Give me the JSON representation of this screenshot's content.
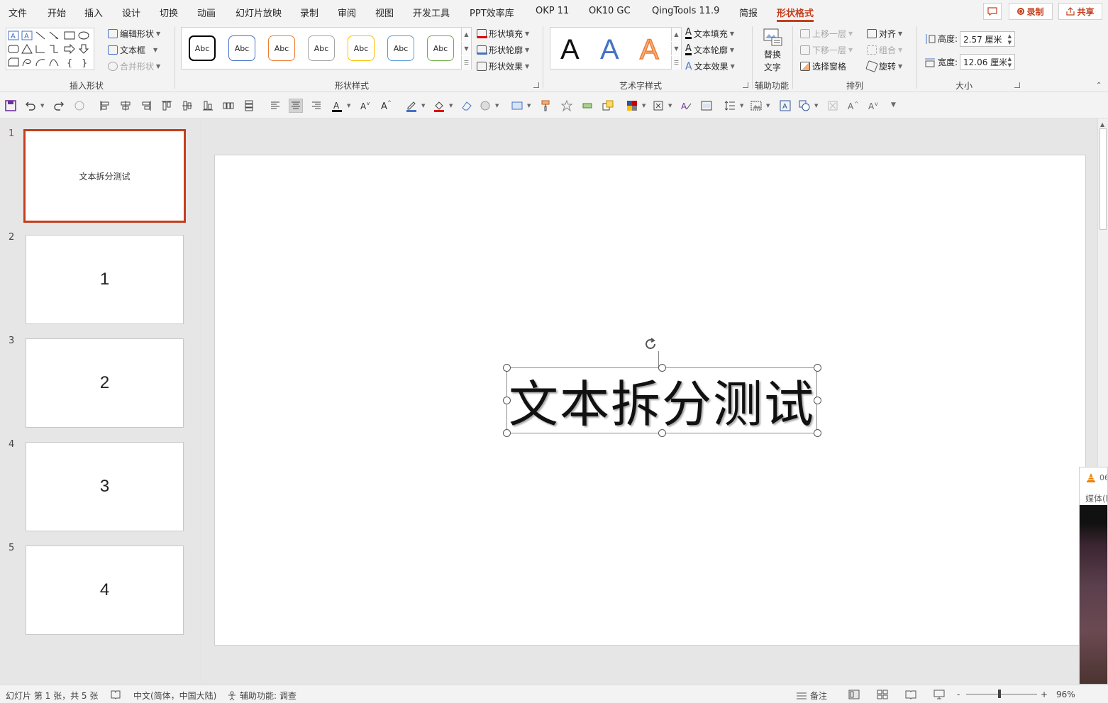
{
  "menu": {
    "tabs": [
      "文件",
      "开始",
      "插入",
      "设计",
      "切换",
      "动画",
      "幻灯片放映",
      "录制",
      "审阅",
      "视图",
      "开发工具",
      "PPT效率库",
      "OKP 11",
      "OK10 GC",
      "QingTools 11.9",
      "简报",
      "形状格式"
    ],
    "active_tab": "形状格式",
    "record_label": "录制",
    "share_label": "共享",
    "accent_color": "#c43e1c"
  },
  "ribbon": {
    "insert_shapes": {
      "label": "插入形状",
      "edit_shape": "编辑形状",
      "text_box": "文本框",
      "merge_shapes": "合并形状"
    },
    "shape_styles": {
      "label": "形状样式",
      "swatch_text": "Abc",
      "swatch_colors": [
        "#000000",
        "#4472c4",
        "#ed7d31",
        "#a5a5a5",
        "#ffc000",
        "#5b9bd5",
        "#70ad47"
      ],
      "shape_fill": "形状填充",
      "shape_outline": "形状轮廓",
      "shape_effects": "形状效果"
    },
    "wordart_styles": {
      "label": "艺术字样式",
      "sample": "A",
      "text_fill": "文本填充",
      "text_outline": "文本轮廓",
      "text_effects": "文本效果"
    },
    "accessibility": {
      "label": "辅助功能",
      "alt_text_line1": "替换",
      "alt_text_line2": "文字"
    },
    "arrange": {
      "label": "排列",
      "bring_forward": "上移一层",
      "send_backward": "下移一层",
      "selection_pane": "选择窗格",
      "align": "对齐",
      "group": "组合",
      "rotate": "旋转"
    },
    "size": {
      "label": "大小",
      "height_label": "高度:",
      "height_value": "2.57 厘米",
      "width_label": "宽度:",
      "width_value": "12.06 厘米"
    }
  },
  "slides": [
    {
      "number": "1",
      "content": "文本拆分测试",
      "selected": true
    },
    {
      "number": "2",
      "content": "1"
    },
    {
      "number": "3",
      "content": "2"
    },
    {
      "number": "4",
      "content": "3"
    },
    {
      "number": "5",
      "content": "4"
    }
  ],
  "main_slide": {
    "text": "文本拆分测试"
  },
  "popup": {
    "title": "06",
    "subtitle": "媒体(M"
  },
  "status": {
    "slide_info": "幻灯片 第 1 张，共 5 张",
    "language": "中文(简体，中国大陆)",
    "accessibility": "辅助功能: 调查",
    "notes": "备注",
    "zoom_minus": "-",
    "zoom_plus": "+",
    "zoom_level": "96%",
    "zoom_fraction": 0.47
  }
}
